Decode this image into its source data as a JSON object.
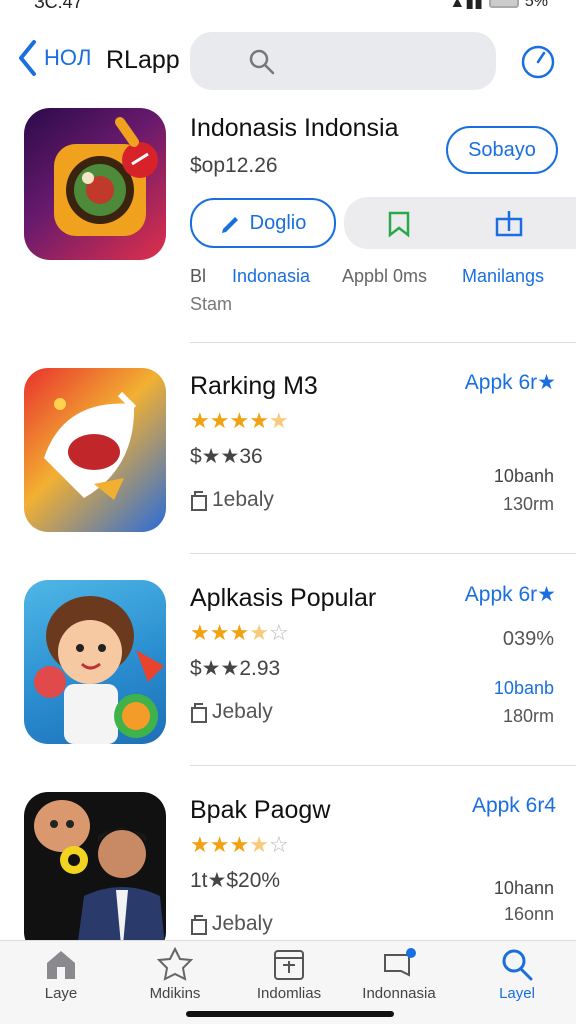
{
  "status": {
    "time": "ЗС:47",
    "battery_label": "5%"
  },
  "nav": {
    "back_label": "HOЛ",
    "title": "RLapp"
  },
  "featured": {
    "name": "Indonasis Indonsia",
    "price": "$op12.26",
    "get_label": "Sobayo",
    "download_label": "Doglio",
    "meta": [
      "Bl",
      "Indonasia",
      "Appbl 0ms",
      "Manilangs"
    ],
    "meta_sub": "Stam"
  },
  "rows": [
    {
      "title": "Rarking M3",
      "rating": 4.5,
      "price": "$★★36",
      "size": "1ebaly",
      "link": "Appk 6r★",
      "stat": "",
      "count": "10banh",
      "mb": "130rm"
    },
    {
      "title": "Aplkasis Popular",
      "rating": 3.5,
      "price": "$★★2.93",
      "size": "Jebaly",
      "link": "Appk 6r★",
      "stat": "039%",
      "count": "10banb",
      "mb": "180rm"
    },
    {
      "title": "Bpak Paogw",
      "rating": 3.5,
      "price": "1t★$20%",
      "size": "Jebaly",
      "link": "Appk 6r4",
      "stat": "",
      "count": "10hann",
      "mb": "16onn"
    }
  ],
  "tabs": [
    {
      "label": "Laye",
      "icon": "home-icon"
    },
    {
      "label": "Mdikins",
      "icon": "star-badge-icon"
    },
    {
      "label": "Indomlias",
      "icon": "calendar-icon"
    },
    {
      "label": "Indonnasia",
      "icon": "notification-icon"
    },
    {
      "label": "Layel",
      "icon": "search-icon"
    }
  ],
  "colors": {
    "accent": "#1a6fe0",
    "star": "#f2a111",
    "star_empty": "#b9b9b9"
  }
}
